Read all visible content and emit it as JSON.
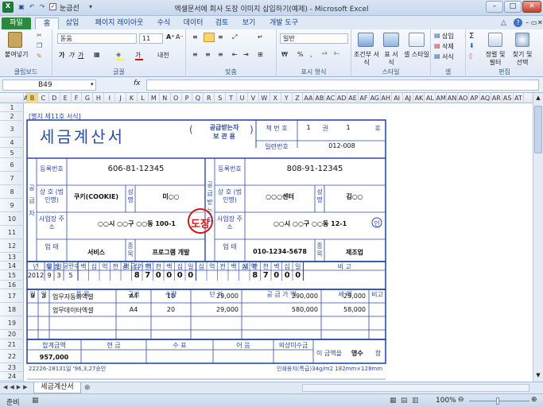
{
  "window": {
    "title": "엑셀문서에 회사 도장 이미지 삽입하기(예제) - Microsoft Excel",
    "qat_label": "눈금선"
  },
  "tabs": [
    "파일",
    "홈",
    "삽입",
    "페이지 레이아웃",
    "수식",
    "데이터",
    "검토",
    "보기",
    "개발 도구"
  ],
  "ribbon": {
    "paste": "붙여넣기",
    "clipboard": "클립보드",
    "font_name": "돋움",
    "font_size": "11",
    "font": "글꼴",
    "align": "맞춤",
    "number_format": "일반",
    "number": "표시 형식",
    "cond": "조건부 서식",
    "table": "표 서식",
    "cellstyle": "셀 스타일",
    "style": "스타일",
    "insert": "삽입",
    "delete": "삭제",
    "format": "서식",
    "cells": "셀",
    "sort": "정렬 및 필터",
    "find": "찾기 및 선택",
    "edit": "편집"
  },
  "formula": {
    "cell": "B49",
    "fx": "fx"
  },
  "columns": [
    "A",
    "B",
    "C",
    "D",
    "E",
    "F",
    "G",
    "H",
    "I",
    "J",
    "K",
    "L",
    "M",
    "N",
    "O",
    "P",
    "Q",
    "R",
    "S",
    "T",
    "U",
    "V",
    "W",
    "X",
    "Y",
    "Z",
    "AA",
    "AB",
    "AC",
    "AD",
    "AE",
    "AF",
    "AG",
    "AH",
    "AI",
    "AJ",
    "AK",
    "AL",
    "AM",
    "AN",
    "AO",
    "AP",
    "AQ",
    "AR",
    "AS",
    "AT"
  ],
  "rows": [
    "1",
    "2",
    "3",
    "4",
    "5",
    "6",
    "7",
    "8",
    "9",
    "10",
    "11",
    "12",
    "13",
    "14",
    "15",
    "16",
    "17",
    "18",
    "19",
    "20",
    "21",
    "22",
    "23",
    "24",
    "25",
    "26"
  ],
  "form": {
    "form_no": "[별지 제11호 서식]",
    "title": "세금계산서",
    "copy_line1": "공급받는자",
    "copy_line2": "보 관 용",
    "paren_l": "(",
    "paren_r": ")",
    "book_label": "책 번 호",
    "book_no": "1",
    "book_unit": "권",
    "book_no2": "1",
    "book_unit2": "호",
    "serial_label": "일련번호",
    "serial": "012-008",
    "supplier_side": "공 급 자",
    "buyer_side": "공급받는자",
    "reg_label": "등록번호",
    "supplier_reg": "606-81-12345",
    "buyer_reg": "808-91-12345",
    "name_label": "상 호 (법인명)",
    "supplier_name": "쿠키(COOKIE)",
    "rep_label": "성명",
    "supplier_rep": "미○○",
    "buyer_name": "○○○센터",
    "buyer_rep": "김○○",
    "addr_label": "사업장 주 소",
    "supplier_addr": "○○시 ○○구 ○○동 100-1",
    "buyer_addr": "○○시 ○○구 ○○동 12-1",
    "seal": "인",
    "stamp": "도장",
    "type_label": "업 태",
    "item_label": "종목",
    "supplier_type": "서비스",
    "supplier_item": "프로그램 개발",
    "buyer_type": "010-1234-5678",
    "buyer_item": "제조업",
    "h_date": "작 성",
    "h_supply": "공 급 가 액",
    "h_tax": "세 액",
    "h_note": "비 고",
    "h_year": "년",
    "h_month": "월",
    "h_day": "일",
    "h_blank": "공란수",
    "digits": [
      "백",
      "십",
      "억",
      "천",
      "백",
      "십",
      "만",
      "천",
      "백",
      "십",
      "일"
    ],
    "year": "2012",
    "month": "9",
    "day": "3",
    "blanks": "5",
    "supply_digits": [
      "8",
      "7",
      "0",
      "0",
      "0",
      "0"
    ],
    "tax_digits": [
      "8",
      "7",
      "0",
      "0",
      "0"
    ],
    "ih_month": "월",
    "ih_day": "일",
    "ih_item": "품 목",
    "ih_spec": "규격",
    "ih_qty": "수량",
    "ih_price": "단 가",
    "ih_amount": "공 급 가 액",
    "ih_tax": "세 액",
    "ih_note": "비고",
    "items": [
      {
        "m": "9",
        "d": "3",
        "item": "업무자동화엑셀",
        "spec": "A4",
        "qty": "10",
        "price": "29,000",
        "amount": "290,000",
        "tax": "29,000"
      },
      {
        "m": "",
        "d": "",
        "item": "업무데이터엑셀",
        "spec": "A4",
        "qty": "20",
        "price": "29,000",
        "amount": "580,000",
        "tax": "58,000"
      }
    ],
    "f_total": "합계금액",
    "f_cash": "현 금",
    "f_check": "수 표",
    "f_bill": "어 음",
    "f_credit": "외상미수금",
    "total": "957,000",
    "receipt_pre": "이 금액을",
    "receipt_word": "영수",
    "receipt_post": "함",
    "footer_left": "22226-28131일 '96,3,27승인",
    "footer_right": "인쇄용지(특급)34g/m2 182mm×128mm",
    "row25_text": "[별지 제11호 서식]"
  },
  "sheet_tab": "세금계산서",
  "status": {
    "ready": "준비",
    "zoom": "100%"
  }
}
